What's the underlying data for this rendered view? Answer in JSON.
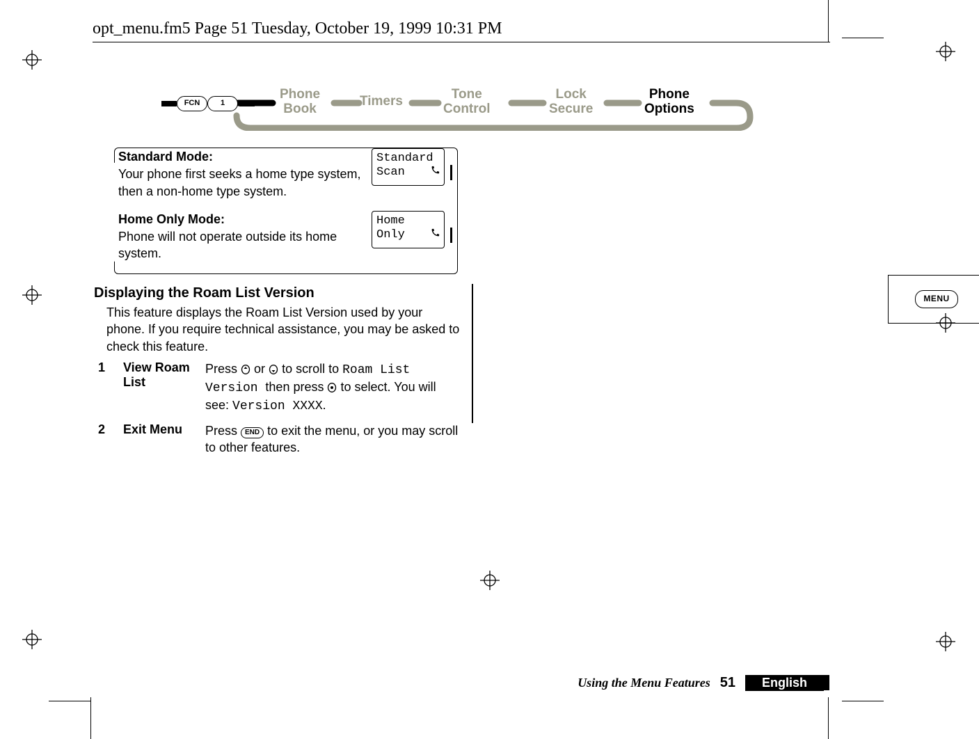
{
  "header": {
    "file_line": "opt_menu.fm5  Page 51  Tuesday, October 19, 1999  10:31 PM"
  },
  "nav": {
    "fcn_label": "FCN",
    "one_label": "1",
    "phone_book": "Phone Book",
    "timers": "Timers",
    "tone_control": "Tone Control",
    "lock_secure": "Lock Secure",
    "phone_options": "Phone Options"
  },
  "modes": {
    "standard": {
      "title": "Standard Mode:",
      "desc": "Your phone first seeks a home type system, then a non-home type system.",
      "lcd": {
        "line1": "Standard",
        "line2": "Scan"
      }
    },
    "home_only": {
      "title": "Home Only Mode:",
      "desc": "Phone will not operate outside its home system.",
      "lcd": {
        "line1": "Home",
        "line2": "Only"
      }
    }
  },
  "roam": {
    "title": "Displaying the Roam List Version",
    "para": "This feature displays the Roam List Version used by your phone. If you require technical assistance, you may be asked to check this feature.",
    "step1": {
      "num": "1",
      "label": "View Roam List",
      "pre": "Press ",
      "mid": " or ",
      "mid2": " to scroll to ",
      "seg1": "Roam List Version ",
      "then": "then press ",
      "post_sel": " to select. You will see: ",
      "seg2": "Version XXXX",
      "tail": "."
    },
    "step2": {
      "num": "2",
      "label": "Exit Menu",
      "pre": "Press ",
      "end": "END",
      "post": " to exit the menu, or you may scroll to other features."
    }
  },
  "side": {
    "menu_label": "MENU"
  },
  "footer": {
    "caption": "Using the Menu Features",
    "page_num": "51",
    "language": "English"
  }
}
